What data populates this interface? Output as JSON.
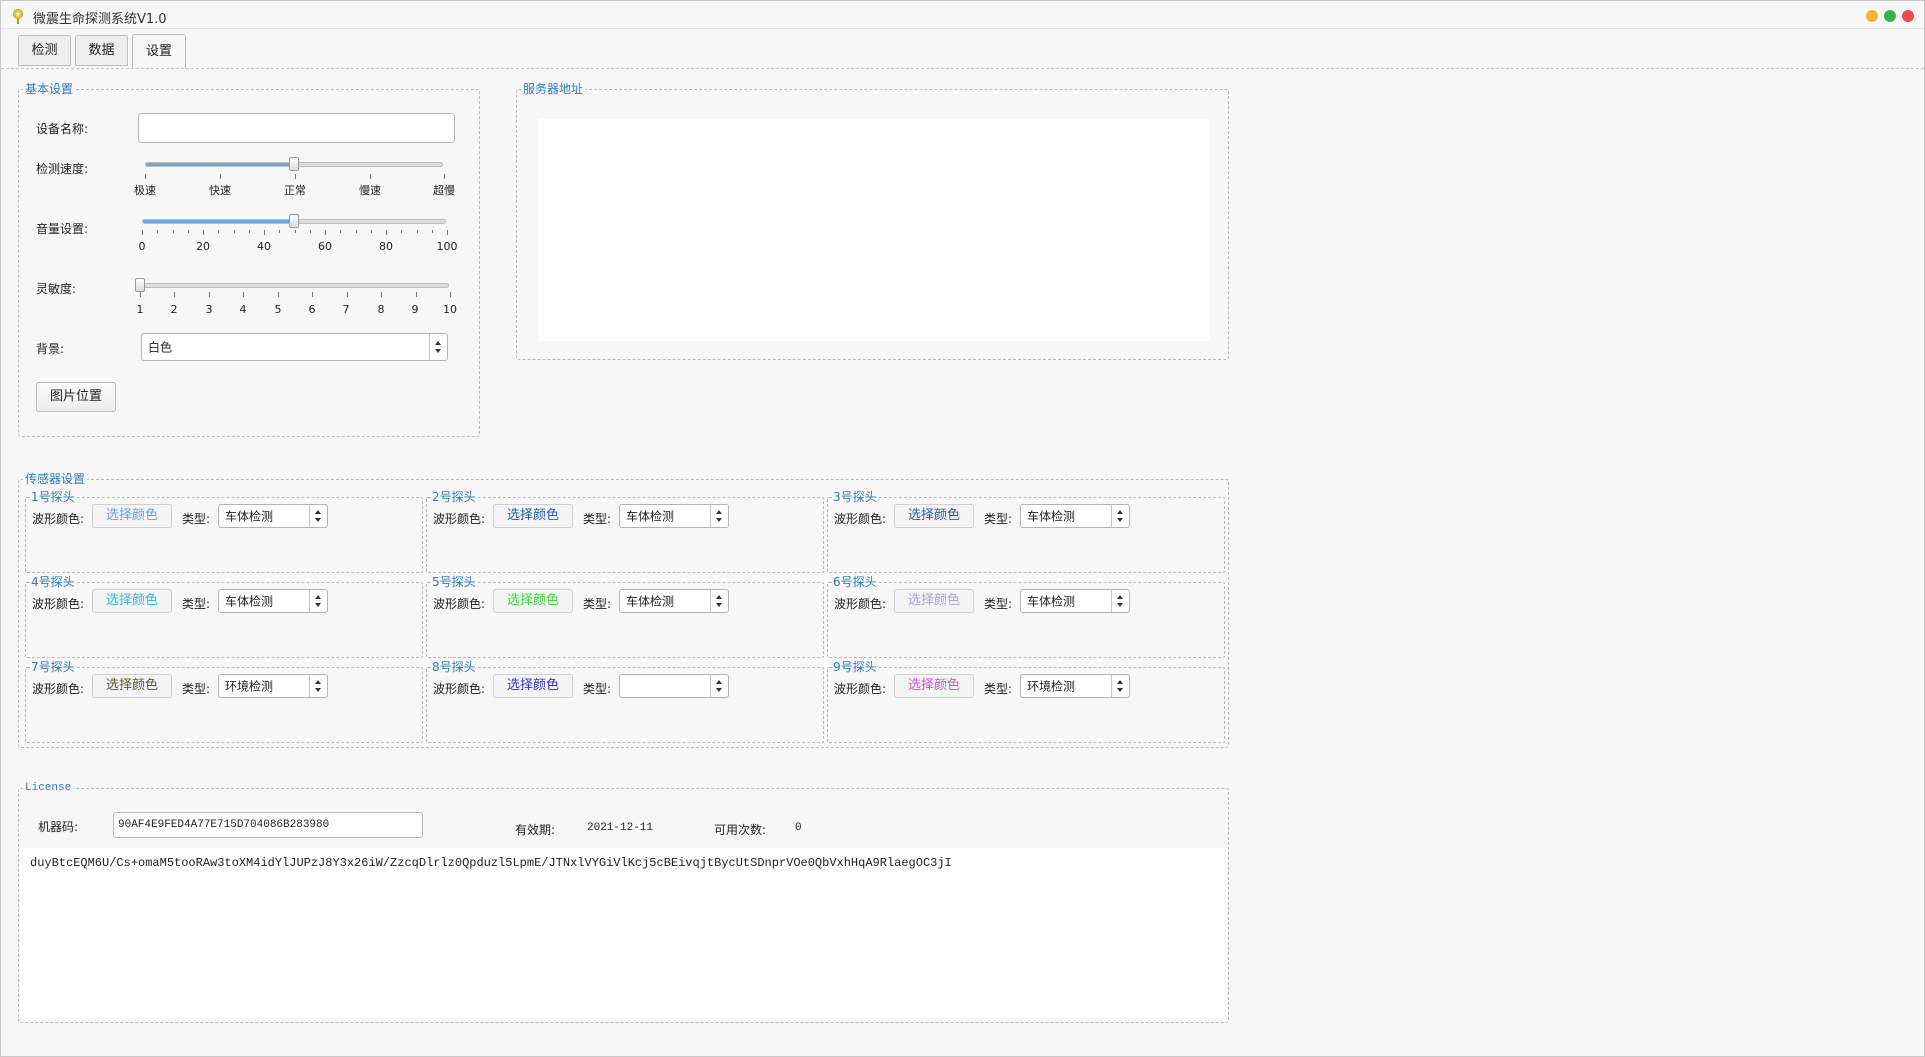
{
  "window": {
    "title": "微震生命探测系统V1.0"
  },
  "tabs": [
    {
      "label": "检测"
    },
    {
      "label": "数据"
    },
    {
      "label": "设置"
    }
  ],
  "basic": {
    "title": "基本设置",
    "device_name_label": "设备名称:",
    "device_name_value": "",
    "speed_label": "检测速度:",
    "speed_ticks": [
      "极速",
      "快速",
      "正常",
      "慢速",
      "超慢"
    ],
    "speed_value": "正常",
    "volume_label": "音量设置:",
    "volume_ticks": [
      "0",
      "20",
      "40",
      "60",
      "80",
      "100"
    ],
    "volume_value": 50,
    "sensitivity_label": "灵敏度:",
    "sensitivity_ticks": [
      "1",
      "2",
      "3",
      "4",
      "5",
      "6",
      "7",
      "8",
      "9",
      "10"
    ],
    "sensitivity_value": 1,
    "background_label": "背景:",
    "background_value": "白色",
    "image_button": "图片位置"
  },
  "server": {
    "title": "服务器地址"
  },
  "sensors": {
    "title": "传感器设置",
    "color_label": "波形颜色:",
    "type_label": "类型:",
    "probes": [
      {
        "name": "1号探头",
        "button": "选择颜色",
        "color": "#5aa7e8",
        "type": "车体检测"
      },
      {
        "name": "2号探头",
        "button": "选择颜色",
        "color": "#1f5fa8",
        "type": "车体检测"
      },
      {
        "name": "3号探头",
        "button": "选择颜色",
        "color": "#1f5fa8",
        "type": "车体检测"
      },
      {
        "name": "4号探头",
        "button": "选择颜色",
        "color": "#39b7e6",
        "type": "车体检测"
      },
      {
        "name": "5号探头",
        "button": "选择颜色",
        "color": "#3fd63f",
        "type": "车体检测"
      },
      {
        "name": "6号探头",
        "button": "选择颜色",
        "color": "#a7a2e0",
        "type": "车体检测"
      },
      {
        "name": "7号探头",
        "button": "选择颜色",
        "color": "#5a5a2a",
        "type": "环境检测"
      },
      {
        "name": "8号探头",
        "button": "选择颜色",
        "color": "#2f2fc9",
        "type": ""
      },
      {
        "name": "9号探头",
        "button": "选择颜色",
        "color": "#d64fd6",
        "type": "环境检测"
      }
    ]
  },
  "license": {
    "title": "License",
    "machine_label": "机器码:",
    "machine_code": "90AF4E9FED4A77E715D704086B283980",
    "expiry_label": "有效期:",
    "expiry_value": "2021-12-11",
    "uses_label": "可用次数:",
    "uses_value": "0",
    "key_text": "duyBtcEQM6U/Cs+omaM5tooRAw3toXM4idYlJUPzJ8Y3x26iW/ZzcqDlrlz0Qpduzl5LpmE/JTNxlVYGiVlKcj5cBEivqjtBycUtSDnprVOe0QbVxhHqA9RlaegOC3jI"
  }
}
